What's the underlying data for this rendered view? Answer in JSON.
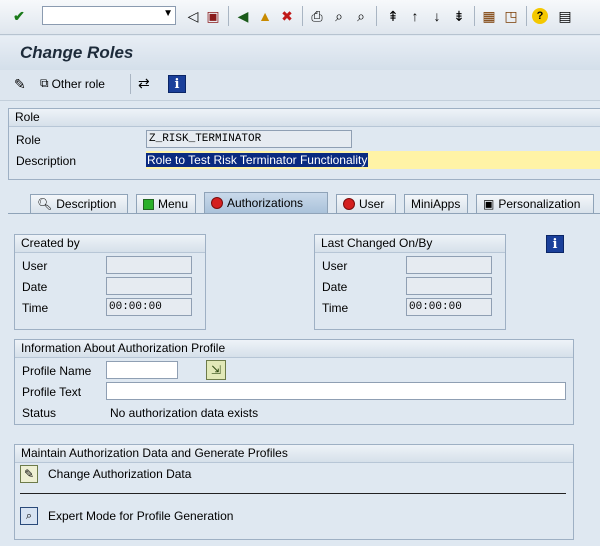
{
  "screen": {
    "title": "Change Roles"
  },
  "app_toolbar": {
    "other_role": "Other role"
  },
  "role_section": {
    "header": "Role",
    "role_label": "Role",
    "role_value": "Z_RISK_TERMINATOR",
    "description_label": "Description",
    "description_value": "Role to Test Risk Terminator Functionality"
  },
  "tabs": [
    {
      "label": "Description"
    },
    {
      "label": "Menu"
    },
    {
      "label": "Authorizations"
    },
    {
      "label": "User"
    },
    {
      "label": "MiniApps"
    },
    {
      "label": "Personalization"
    }
  ],
  "created_by": {
    "header": "Created by",
    "user_label": "User",
    "user_value": "",
    "date_label": "Date",
    "date_value": "",
    "time_label": "Time",
    "time_value": "00:00:00"
  },
  "last_changed": {
    "header": "Last Changed On/By",
    "user_label": "User",
    "user_value": "",
    "date_label": "Date",
    "date_value": "",
    "time_label": "Time",
    "time_value": "00:00:00"
  },
  "auth_profile": {
    "header": "Information About Authorization Profile",
    "profile_name_label": "Profile Name",
    "profile_name_value": "",
    "profile_text_label": "Profile Text",
    "profile_text_value": "",
    "status_label": "Status",
    "status_value": "No authorization data exists"
  },
  "maintain": {
    "header": "Maintain Authorization Data and Generate Profiles",
    "change_button": "Change Authorization Data",
    "expert_button": "Expert Mode for Profile Generation"
  },
  "colors": {
    "highlight": "#fff3a6",
    "selection": "#0a2a80",
    "tab_active": "#b8cde3"
  }
}
